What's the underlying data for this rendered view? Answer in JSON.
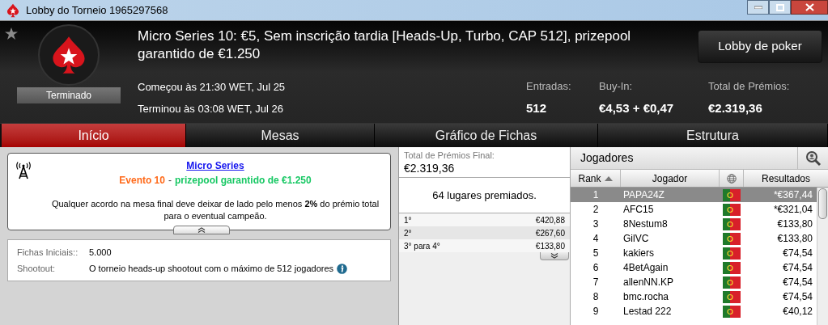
{
  "window": {
    "title": "Lobby do Torneio 1965297568"
  },
  "header": {
    "title": "Micro Series 10: €5, Sem inscrição tardia [Heads-Up, Turbo, CAP 512], prizepool garantido de €1.250",
    "status": "Terminado",
    "started": "Começou às 21:30 WET, Jul 25",
    "ended": "Terminou às 03:08 WET, Jul 26",
    "favorite": false,
    "lobby_button": "Lobby de poker",
    "stats": [
      {
        "label": "Entradas:",
        "value": "512"
      },
      {
        "label": "Buy-In:",
        "value": "€4,53 + €0,47"
      },
      {
        "label": "Total de Prémios:",
        "value": "€2.319,36"
      }
    ]
  },
  "tabs": [
    {
      "label": "Início",
      "selected": true
    },
    {
      "label": "Mesas",
      "selected": false
    },
    {
      "label": "Gráfico de Fichas",
      "selected": false
    },
    {
      "label": "Estrutura",
      "selected": false
    }
  ],
  "announcement": {
    "link": "Micro Series",
    "event": "Evento 10",
    "separator": "-",
    "guarantee": "prizepool garantido de €1.250",
    "text": "Qualquer acordo na mesa final deve deixar de lado pelo menos **2%** do prémio total para o eventual campeão."
  },
  "details": [
    {
      "label": "Fichas Iniciais::",
      "value": "5.000",
      "info": false
    },
    {
      "label": "Shootout:",
      "value": "O torneio heads-up shootout com o máximo de 512 jogadores",
      "info": true
    }
  ],
  "prizes": {
    "label": "Total de Prémios Final:",
    "total": "€2.319,36",
    "places": "64 lugares premiados.",
    "rows": [
      {
        "place": "1°",
        "amount": "€420,88"
      },
      {
        "place": "2°",
        "amount": "€267,60"
      },
      {
        "place": "3° para 4°",
        "amount": "€133,80"
      }
    ]
  },
  "players": {
    "title": "Jogadores",
    "columns": [
      "Rank",
      "Jogador",
      "Resultados"
    ],
    "rows": [
      {
        "rank": "1",
        "name": "PAPA24Z",
        "result": "*€367,44",
        "selected": true
      },
      {
        "rank": "2",
        "name": "AFC15",
        "result": "*€321,04",
        "selected": false
      },
      {
        "rank": "3",
        "name": "8Nestum8",
        "result": "€133,80",
        "selected": false
      },
      {
        "rank": "4",
        "name": "GilVC",
        "result": "€133,80",
        "selected": false
      },
      {
        "rank": "5",
        "name": "kakiers",
        "result": "€74,54",
        "selected": false
      },
      {
        "rank": "6",
        "name": "4BetAgain",
        "result": "€74,54",
        "selected": false
      },
      {
        "rank": "7",
        "name": "allenNN.KP",
        "result": "€74,54",
        "selected": false
      },
      {
        "rank": "8",
        "name": "bmc.rocha",
        "result": "€74,54",
        "selected": false
      },
      {
        "rank": "9",
        "name": "Lestad 222",
        "result": "€40,12",
        "selected": false
      }
    ]
  }
}
